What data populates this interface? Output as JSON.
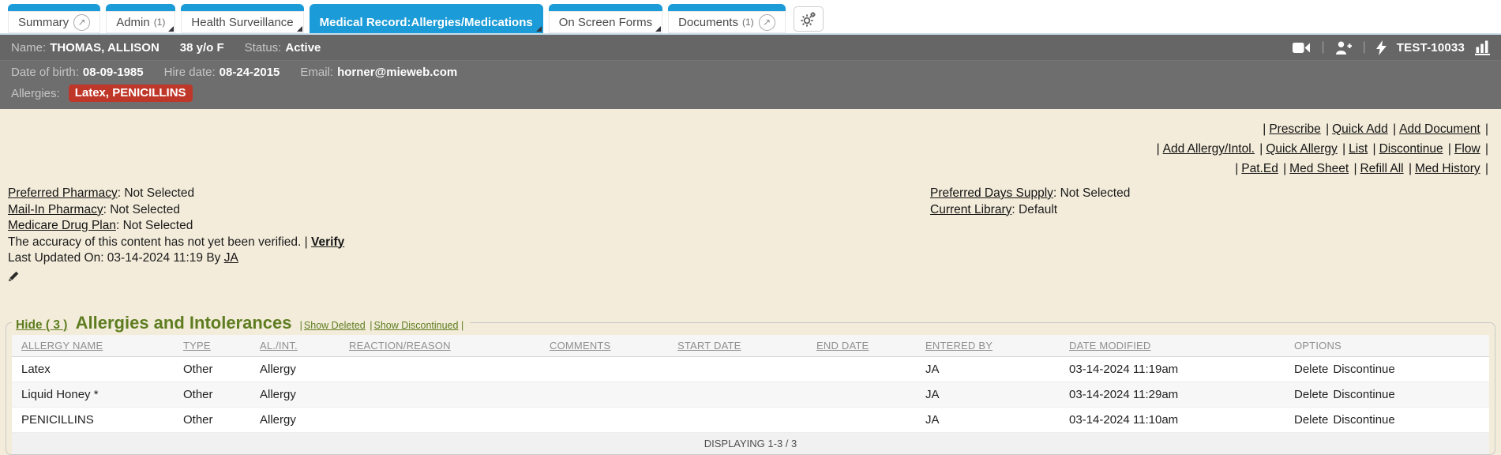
{
  "colors": {
    "accent_blue": "#1b9bd7",
    "banner_gray": "#696969",
    "badge_red": "#bf3728",
    "heading_green": "#5e7d20",
    "page_cream": "#f3ecda"
  },
  "separators": {
    "pipe": "|",
    "colon": ":"
  },
  "tabs": {
    "summary": {
      "label": "Summary"
    },
    "admin": {
      "label": "Admin",
      "count": "(1)"
    },
    "health_surveillance": {
      "label": "Health Surveillance"
    },
    "medical_record": {
      "label": "Medical Record:Allergies/Medications"
    },
    "on_screen_forms": {
      "label": "On Screen Forms"
    },
    "documents": {
      "label": "Documents",
      "count": "(1)"
    }
  },
  "patient_bar": {
    "name_label": "Name:",
    "name": "THOMAS, ALLISON",
    "age_sex": "38 y/o F",
    "status_label": "Status:",
    "status": "Active",
    "chart_id": "TEST-10033",
    "dob_label": "Date of birth:",
    "dob": "08-09-1985",
    "hire_label": "Hire date:",
    "hire_date": "08-24-2015",
    "email_label": "Email:",
    "email": "horner@mieweb.com",
    "allergies_label": "Allergies:",
    "allergies_badge": "Latex, PENICILLINS"
  },
  "actions": {
    "row1": [
      "Prescribe",
      "Quick Add",
      "Add Document"
    ],
    "row2": [
      "Add Allergy/Intol.",
      "Quick Allergy",
      "List",
      "Discontinue",
      "Flow"
    ],
    "row3": [
      "Pat.Ed",
      "Med Sheet",
      "Refill All",
      "Med History"
    ]
  },
  "pharmacy": {
    "items": [
      {
        "label": "Preferred Pharmacy",
        "value": "Not Selected"
      },
      {
        "label": "Mail-In Pharmacy",
        "value": "Not Selected"
      },
      {
        "label": "Medicare Drug Plan",
        "value": "Not Selected"
      }
    ],
    "verify_text": "The accuracy of this content has not yet been verified.",
    "verify_link": "Verify",
    "last_updated": "Last Updated On: 03-14-2024 11:19 By",
    "last_updated_by": "JA"
  },
  "supply": {
    "items": [
      {
        "label": "Preferred Days Supply",
        "value": "Not Selected"
      },
      {
        "label": "Current Library",
        "value": "Default"
      }
    ]
  },
  "allergies_section": {
    "hide_link": "Hide ( 3 )",
    "title": "Allergies and Intolerances",
    "show_deleted": "Show Deleted",
    "show_discontinued": "Show Discontinued",
    "table": {
      "headers": [
        "ALLERGY NAME",
        "TYPE",
        "AL./INT.",
        "REACTION/REASON",
        "COMMENTS",
        "START DATE",
        "END DATE",
        "ENTERED BY",
        "DATE MODIFIED",
        "OPTIONS"
      ],
      "rows": [
        {
          "allergy_name": "Latex",
          "type": "Other",
          "al_int": "Allergy",
          "reaction": "",
          "comments": "",
          "start_date": "",
          "end_date": "",
          "entered_by": "JA",
          "date_modified": "03-14-2024 11:19am",
          "delete_label": "Delete",
          "discontinue_label": "Discontinue"
        },
        {
          "allergy_name": "Liquid Honey *",
          "type": "Other",
          "al_int": "Allergy",
          "reaction": "",
          "comments": "",
          "start_date": "",
          "end_date": "",
          "entered_by": "JA",
          "date_modified": "03-14-2024 11:29am",
          "delete_label": "Delete",
          "discontinue_label": "Discontinue"
        },
        {
          "allergy_name": "PENICILLINS",
          "type": "Other",
          "al_int": "Allergy",
          "reaction": "",
          "comments": "",
          "start_date": "",
          "end_date": "",
          "entered_by": "JA",
          "date_modified": "03-14-2024 11:10am",
          "delete_label": "Delete",
          "discontinue_label": "Discontinue"
        }
      ],
      "footer": "DISPLAYING 1-3 / 3"
    }
  },
  "icons": {
    "popout": "open-in-new-window",
    "settings": "gears",
    "video": "video-call",
    "add_person": "add-person",
    "lightning": "quick-action",
    "chart": "growth-chart",
    "pencil": "edit-pencil"
  }
}
